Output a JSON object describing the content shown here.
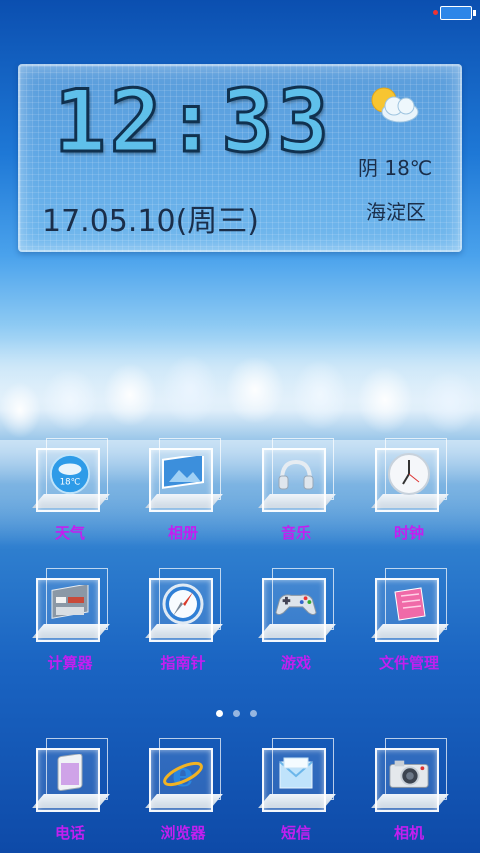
{
  "status_bar": {
    "battery_color": "#2e86e8"
  },
  "widget": {
    "time": "12:33",
    "date": "17.05.10(周三)",
    "weather_icon": "partly-cloudy-icon",
    "weather_desc": "阴 18℃",
    "location": "海淀区"
  },
  "apps_row1": [
    {
      "label": "天气",
      "icon": "weather-icon",
      "badge": "18℃"
    },
    {
      "label": "相册",
      "icon": "gallery-icon"
    },
    {
      "label": "音乐",
      "icon": "headphones-icon"
    },
    {
      "label": "时钟",
      "icon": "clock-icon"
    }
  ],
  "apps_row2": [
    {
      "label": "计算器",
      "icon": "calculator-icon"
    },
    {
      "label": "指南针",
      "icon": "compass-icon"
    },
    {
      "label": "游戏",
      "icon": "gamepad-icon"
    },
    {
      "label": "文件管理",
      "icon": "folder-icon"
    }
  ],
  "dock": [
    {
      "label": "电话",
      "icon": "phone-icon"
    },
    {
      "label": "浏览器",
      "icon": "browser-icon"
    },
    {
      "label": "短信",
      "icon": "message-icon"
    },
    {
      "label": "相机",
      "icon": "camera-icon"
    }
  ],
  "pager": {
    "pages": 3,
    "active": 1
  },
  "colors": {
    "label": "#c21ff0",
    "clock_fill": "#5fc0ea"
  }
}
